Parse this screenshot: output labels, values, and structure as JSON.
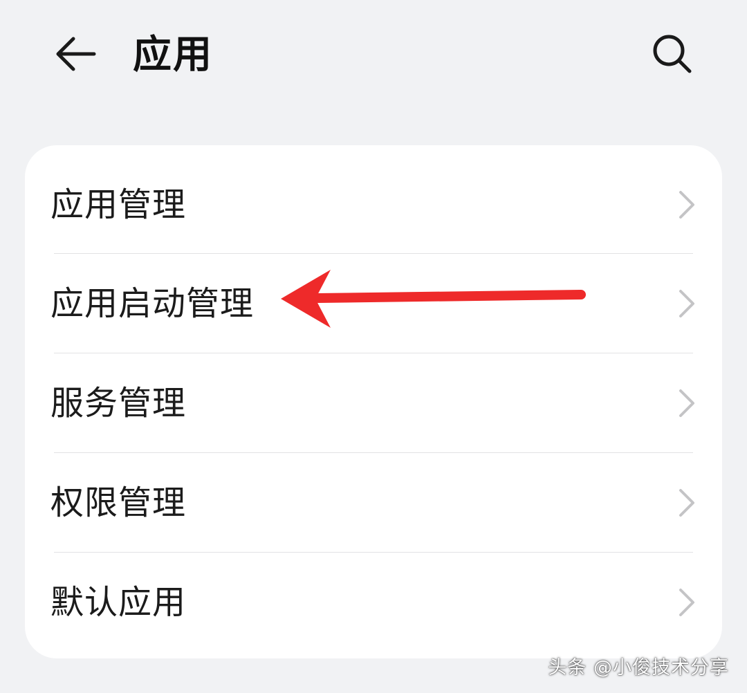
{
  "header": {
    "back_icon": "back-arrow-icon",
    "title": "应用",
    "search_icon": "search-icon"
  },
  "menu": {
    "items": [
      {
        "label": "应用管理",
        "icon": "chevron-right-icon"
      },
      {
        "label": "应用启动管理",
        "icon": "chevron-right-icon"
      },
      {
        "label": "服务管理",
        "icon": "chevron-right-icon"
      },
      {
        "label": "权限管理",
        "icon": "chevron-right-icon"
      },
      {
        "label": "默认应用",
        "icon": "chevron-right-icon"
      }
    ]
  },
  "annotation": {
    "color": "#ee2a2a",
    "points_to": "应用启动管理"
  },
  "watermark": {
    "text": "头条 @小俊技术分享"
  },
  "colors": {
    "background": "#f1f2f4",
    "card": "#ffffff",
    "text": "#1b1b1b",
    "chevron": "#c4c4c6",
    "divider": "#e2e2e4"
  }
}
